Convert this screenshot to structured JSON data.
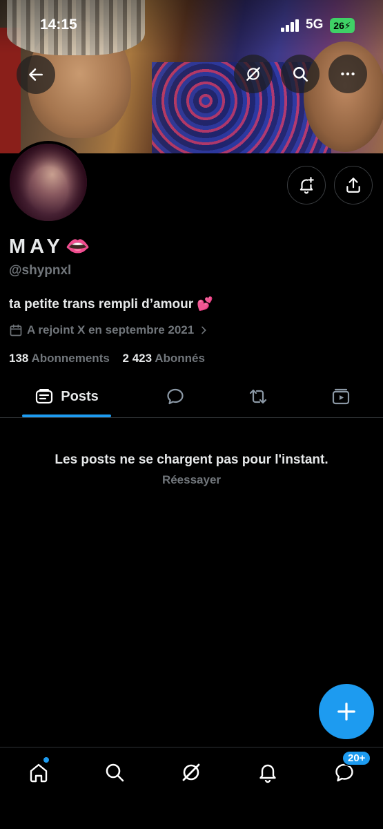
{
  "status_bar": {
    "time": "14:15",
    "network": "5G",
    "battery": "26"
  },
  "profile": {
    "name": "MAY",
    "emoji": "👄",
    "handle": "@shypnxl",
    "bio": "ta petite trans rempli d’amour",
    "bio_emoji": "💕",
    "joined": "A rejoint X en septembre 2021",
    "following_count": "138",
    "following_label": "Abonnements",
    "followers_count": "2 423",
    "followers_label": "Abonnés"
  },
  "tabs": [
    {
      "label": "Posts",
      "icon": "posts-icon",
      "active": true
    },
    {
      "label": "",
      "icon": "reply-bubble-icon",
      "active": false
    },
    {
      "label": "",
      "icon": "repost-icon",
      "active": false
    },
    {
      "label": "",
      "icon": "media-icon",
      "active": false
    }
  ],
  "empty_state": {
    "message": "Les posts ne se chargent pas pour l'instant.",
    "retry": "Réessayer"
  },
  "bottom_nav": {
    "messages_badge": "20+"
  },
  "colors": {
    "accent": "#1d9bf0",
    "muted": "#71767b",
    "text": "#e7e9ea",
    "background": "#000000"
  }
}
